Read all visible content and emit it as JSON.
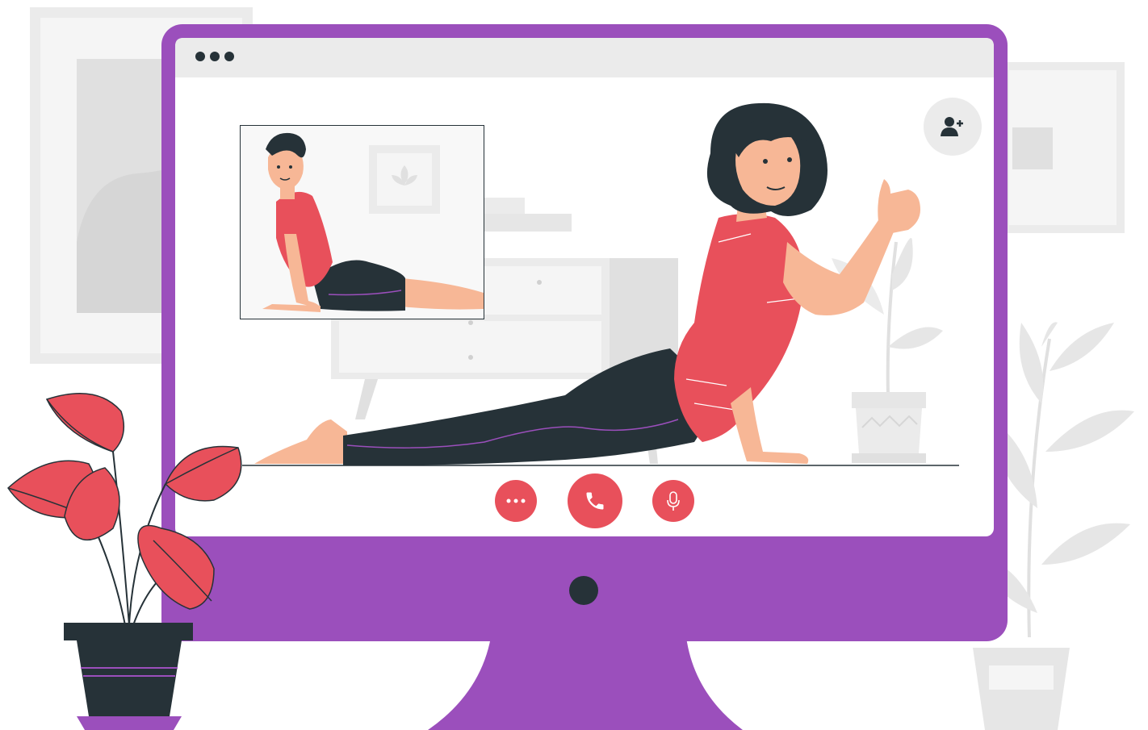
{
  "colors": {
    "monitor_frame": "#9B4FBC",
    "screen_background": "#FFFFFF",
    "titlebar": "#EBEBEB",
    "accent_red": "#E8505B",
    "dark": "#263238",
    "skin": "#F7B796",
    "background_gray": "#EBEBEB",
    "light_gray": "#F5F5F5"
  },
  "window": {
    "titlebar_icon": "more-horizontal-icon"
  },
  "video_call": {
    "add_participant_icon": "add-user-icon",
    "controls": [
      {
        "name": "more-options-button",
        "icon": "ellipsis-icon"
      },
      {
        "name": "call-button",
        "icon": "phone-icon"
      },
      {
        "name": "microphone-button",
        "icon": "microphone-icon"
      }
    ]
  }
}
